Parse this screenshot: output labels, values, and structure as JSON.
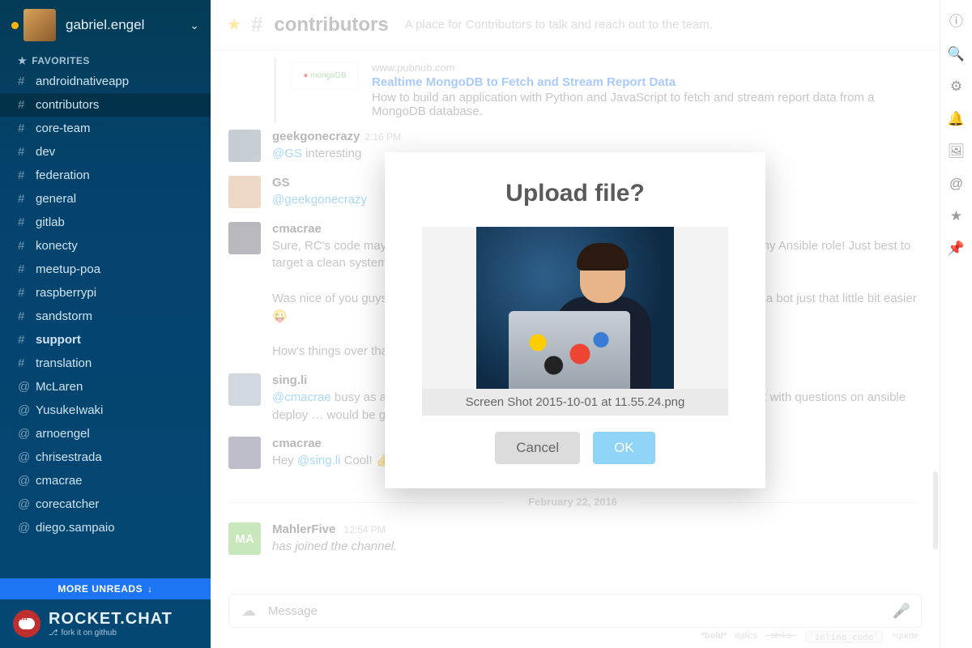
{
  "sidebar": {
    "username": "gabriel.engel",
    "favorites_label": "FAVORITES",
    "items": [
      {
        "label": "androidnativeapp",
        "pre": "#"
      },
      {
        "label": "contributors",
        "pre": "#",
        "active": true
      },
      {
        "label": "core-team",
        "pre": "#"
      },
      {
        "label": "dev",
        "pre": "#"
      },
      {
        "label": "federation",
        "pre": "#"
      },
      {
        "label": "general",
        "pre": "#"
      },
      {
        "label": "gitlab",
        "pre": "#"
      },
      {
        "label": "konecty",
        "pre": "#"
      },
      {
        "label": "meetup-poa",
        "pre": "#"
      },
      {
        "label": "raspberrypi",
        "pre": "#"
      },
      {
        "label": "sandstorm",
        "pre": "#"
      },
      {
        "label": "support",
        "pre": "#",
        "bold": true
      },
      {
        "label": "translation",
        "pre": "#"
      },
      {
        "label": "McLaren",
        "pre": "@"
      },
      {
        "label": "YusukeIwaki",
        "pre": "@"
      },
      {
        "label": "arnoengel",
        "pre": "@"
      },
      {
        "label": "chrisestrada",
        "pre": "@"
      },
      {
        "label": "cmacrae",
        "pre": "@"
      },
      {
        "label": "corecatcher",
        "pre": "@"
      },
      {
        "label": "diego.sampaio",
        "pre": "@"
      }
    ],
    "more_unreads": "MORE UNREADS",
    "brand": "ROCKET.CHAT",
    "fork": "fork it on github"
  },
  "header": {
    "channel": "contributors",
    "topic": "A place for Contributors to talk and reach out to the team."
  },
  "linkcard": {
    "domain": "www.pubnub.com",
    "title": "Realtime MongoDB to Fetch and Stream Report Data",
    "desc": "How to build an application with Python and JavaScript to fetch and stream report data from a MongoDB database.",
    "thumb_label": "mongoDB"
  },
  "messages": [
    {
      "user": "geekgonecrazy",
      "time": "2:16 PM",
      "text": "@GS interesting",
      "av": "av-a"
    },
    {
      "user": "GS",
      "time": "",
      "text": "@geekgonecrazy",
      "av": "av-b"
    },
    {
      "user": "cmacrae",
      "time": "",
      "text": "Sure, RC's code may change a lot, people's hosts may not, and the same can't be said for my Ansible role! Just best to target a clean system 👍\n\nWas nice of you guys to add the curl header for latest version, by the way - made deploying a bot just that little bit easier 😜\n\nHow's things over that side of the pond? 🍺",
      "av": "av-c"
    },
    {
      "user": "sing.li",
      "time": "",
      "text": "@cmacrae  busy as a 🐝 …  and  loving it!  😄    BTW - noticed many users coming into support with questions on ansible deploy  …  would be great if you can drop by when you have a free stretch of time again 😉",
      "av": "av-d"
    },
    {
      "user": "cmacrae",
      "time": "",
      "text": "Hey @sing.li Cool! 👍  Good to hear from you",
      "av": "av-e"
    }
  ],
  "divider": "February 22, 2016",
  "join_msg": {
    "user": "MahlerFive",
    "time": "12:54 PM",
    "text": "has joined the channel.",
    "initials": "MA"
  },
  "composer": {
    "placeholder": "Message"
  },
  "hints": {
    "bold": "*bold*",
    "italics": "italics",
    "strike": "~strike~",
    "code": "`inline_code`",
    "quote": ">quote"
  },
  "rightrail": [
    "ⓘ",
    "🔍",
    "⚙",
    "🔔",
    "🖼",
    "@",
    "★",
    "📌"
  ],
  "modal": {
    "title": "Upload file?",
    "filename": "Screen Shot 2015-10-01 at 11.55.24.png",
    "cancel": "Cancel",
    "ok": "OK"
  }
}
